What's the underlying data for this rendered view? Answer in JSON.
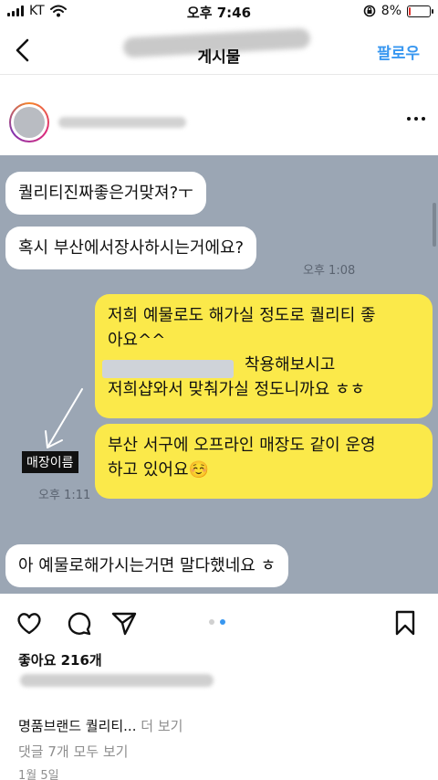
{
  "status_bar": {
    "carrier": "KT",
    "time": "오후 7:46",
    "battery": "8%",
    "battery_level": 0.08
  },
  "nav": {
    "title": "게시물",
    "follow_label": "팔로우"
  },
  "post_image": {
    "messages": [
      {
        "text": "퀄리티진짜좋은거맞져?ㅜ",
        "side": "left"
      },
      {
        "text": "혹시 부산에서장사하시는거에요?",
        "side": "left",
        "time": "오후 1:08"
      },
      {
        "lines": [
          "저희 예물로도 해가실 정도로 퀄리티 좋",
          "아요^^",
          "착용해보시고",
          "저희샵와서 맞춰가실 정도니까요 ㅎㅎ"
        ],
        "side": "right"
      },
      {
        "lines": [
          "부산 서구에 오프라인 매장도 같이 운영",
          "하고 있어요☺️"
        ],
        "side": "right",
        "time": "오후 1:11"
      },
      {
        "text": "아 예물로해가시는거면 말다했네요 ㅎ",
        "side": "left"
      }
    ],
    "store_label": "매장이름"
  },
  "carousel": {
    "count": 2,
    "active_index": 1,
    "active_color": "#3897f0",
    "inactive_color": "#d0d0d0"
  },
  "post": {
    "likes": "좋아요 216개",
    "caption": "명품브랜드 퀄리티...",
    "caption_more": " 더 보기",
    "comments_link": "댓글 7개 모두 보기",
    "date": "1월 5일"
  },
  "icons": [
    "back-icon",
    "wifi-icon",
    "signal-icon",
    "orientation-lock-icon",
    "battery-icon",
    "more-icon",
    "heart-icon",
    "comment-icon",
    "share-icon",
    "bookmark-icon"
  ],
  "colors": {
    "accent": "#3897f0",
    "chat_bg": "#9ba6b4",
    "yellow_bubble": "#fbe94a",
    "white_bubble": "#ffffff"
  }
}
